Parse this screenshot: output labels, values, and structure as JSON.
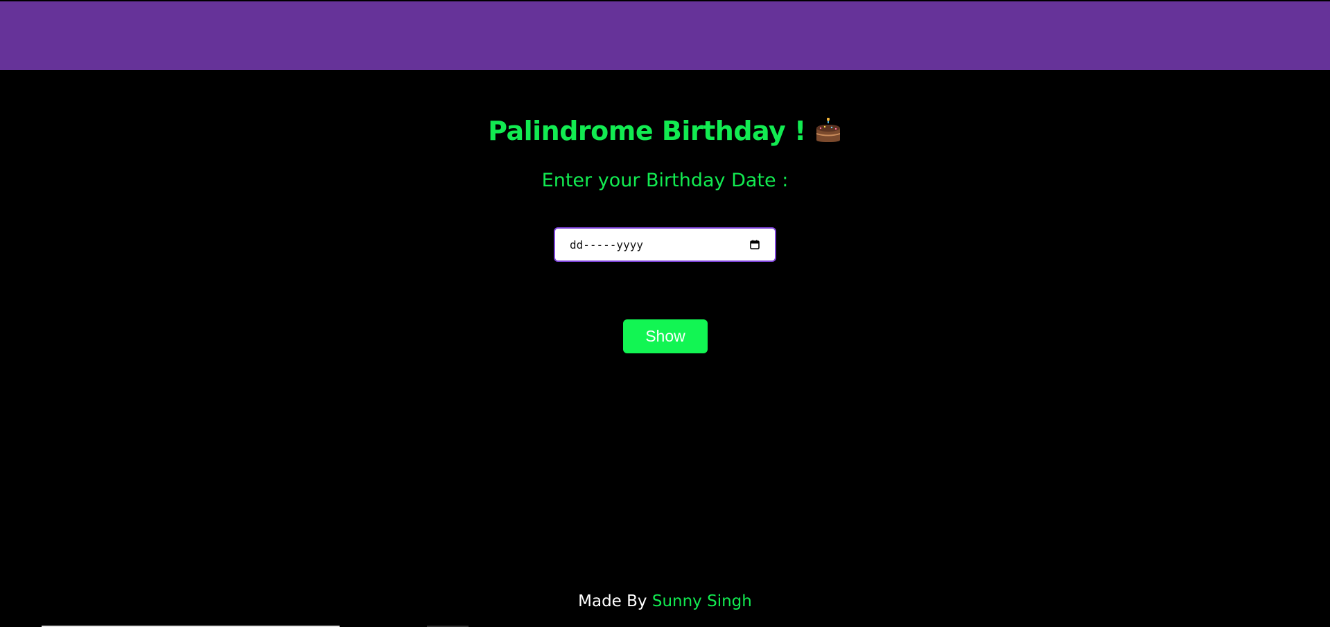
{
  "header": {
    "color": "#663399"
  },
  "main": {
    "title": "Palindrome Birthday !",
    "title_icon": "birthday-cake-icon",
    "prompt": "Enter your Birthday Date :",
    "date_input": {
      "placeholder_text": "dd-----yyyy",
      "icon": "calendar-icon"
    },
    "show_button_label": "Show"
  },
  "footer": {
    "made_by_label": "Made By",
    "author": "Sunny Singh"
  },
  "colors": {
    "background": "#000000",
    "accent_green": "#12eb51",
    "button_green": "#12f553",
    "input_border": "#7d43d9"
  }
}
